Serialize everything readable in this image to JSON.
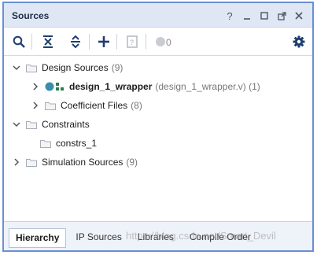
{
  "window": {
    "title": "Sources",
    "controls": {
      "help": "?",
      "minimize": "_",
      "maximize": "□",
      "restore": "⤢",
      "close": "✕"
    }
  },
  "toolbar": {
    "items": [
      "search-icon",
      "collapse-all-icon",
      "expand-all-icon",
      "add-icon",
      "properties-icon",
      "status-dot-icon"
    ],
    "count": "0"
  },
  "tree": [
    {
      "label": "Design Sources",
      "count": "(9)",
      "expanded": true
    },
    {
      "label": "design_1_wrapper",
      "detail": "(design_1_wrapper.v) (1)",
      "expanded": false
    },
    {
      "label": "Coefficient Files",
      "count": "(8)",
      "expanded": false
    },
    {
      "label": "Constraints",
      "count": "",
      "expanded": true
    },
    {
      "label": "constrs_1",
      "count": ""
    },
    {
      "label": "Simulation Sources",
      "count": "(9)",
      "expanded": false
    }
  ],
  "tabs": [
    {
      "label": "Hierarchy",
      "active": true
    },
    {
      "label": "IP Sources",
      "active": false
    },
    {
      "label": "Libraries",
      "active": false
    },
    {
      "label": "Compile Order",
      "active": false
    }
  ],
  "watermark": "https://blog.csdn.net/Smart_Devil",
  "colors": {
    "accent": "#6b8fd1",
    "titlebar": "#dfe7f5",
    "blue-icon": "#1f5fb0",
    "teal-dot": "#3a8fa8"
  }
}
